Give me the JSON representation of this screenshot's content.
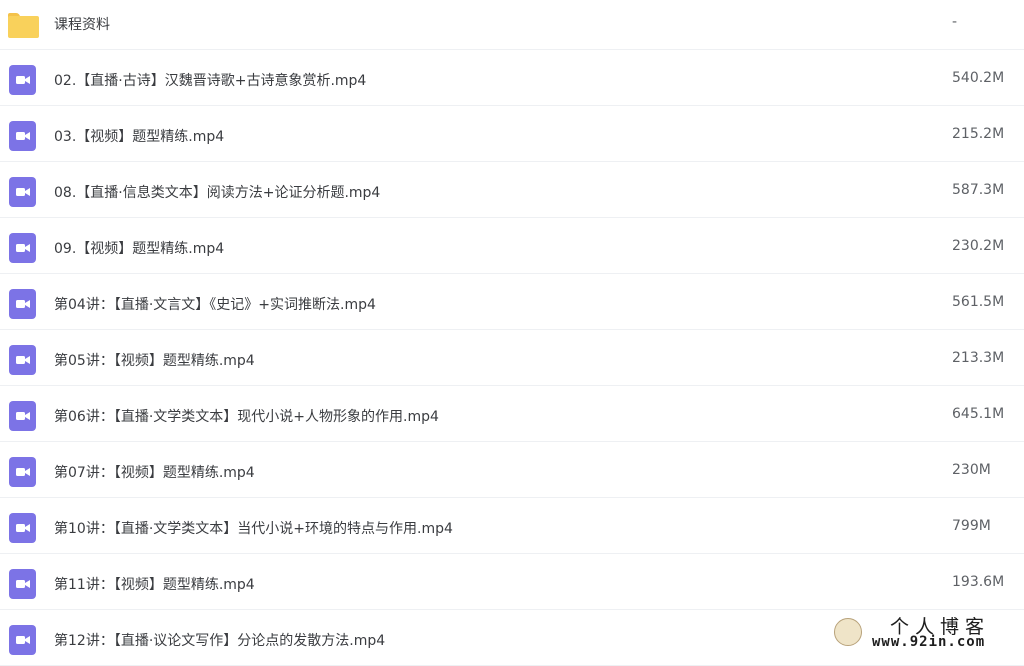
{
  "file_list": {
    "rows": [
      {
        "icon": "folder-icon",
        "name": "课程资料",
        "size": "-"
      },
      {
        "icon": "video-file-icon",
        "name": "02.【直播·古诗】汉魏晋诗歌+古诗意象赏析.mp4",
        "size": "540.2M"
      },
      {
        "icon": "video-file-icon",
        "name": "03.【视频】题型精练.mp4",
        "size": "215.2M"
      },
      {
        "icon": "video-file-icon",
        "name": "08.【直播·信息类文本】阅读方法+论证分析题.mp4",
        "size": "587.3M"
      },
      {
        "icon": "video-file-icon",
        "name": "09.【视频】题型精练.mp4",
        "size": "230.2M"
      },
      {
        "icon": "video-file-icon",
        "name": "第04讲：【直播·文言文】《史记》+实词推断法.mp4",
        "size": "561.5M"
      },
      {
        "icon": "video-file-icon",
        "name": "第05讲：【视频】题型精练.mp4",
        "size": "213.3M"
      },
      {
        "icon": "video-file-icon",
        "name": "第06讲：【直播·文学类文本】现代小说+人物形象的作用.mp4",
        "size": "645.1M"
      },
      {
        "icon": "video-file-icon",
        "name": "第07讲：【视频】题型精练.mp4",
        "size": "230M"
      },
      {
        "icon": "video-file-icon",
        "name": "第10讲：【直播·文学类文本】当代小说+环境的特点与作用.mp4",
        "size": "799M"
      },
      {
        "icon": "video-file-icon",
        "name": "第11讲：【视频】题型精练.mp4",
        "size": "193.6M"
      },
      {
        "icon": "video-file-icon",
        "name": "第12讲：【直播·议论文写作】分论点的发散方法.mp4",
        "size": ""
      }
    ]
  },
  "watermark": {
    "title": "个人博客",
    "url": "www.92in.com"
  },
  "colors": {
    "folder": "#f9d15b",
    "video_icon": "#7c73e6",
    "row_divider": "#eef0f3"
  }
}
